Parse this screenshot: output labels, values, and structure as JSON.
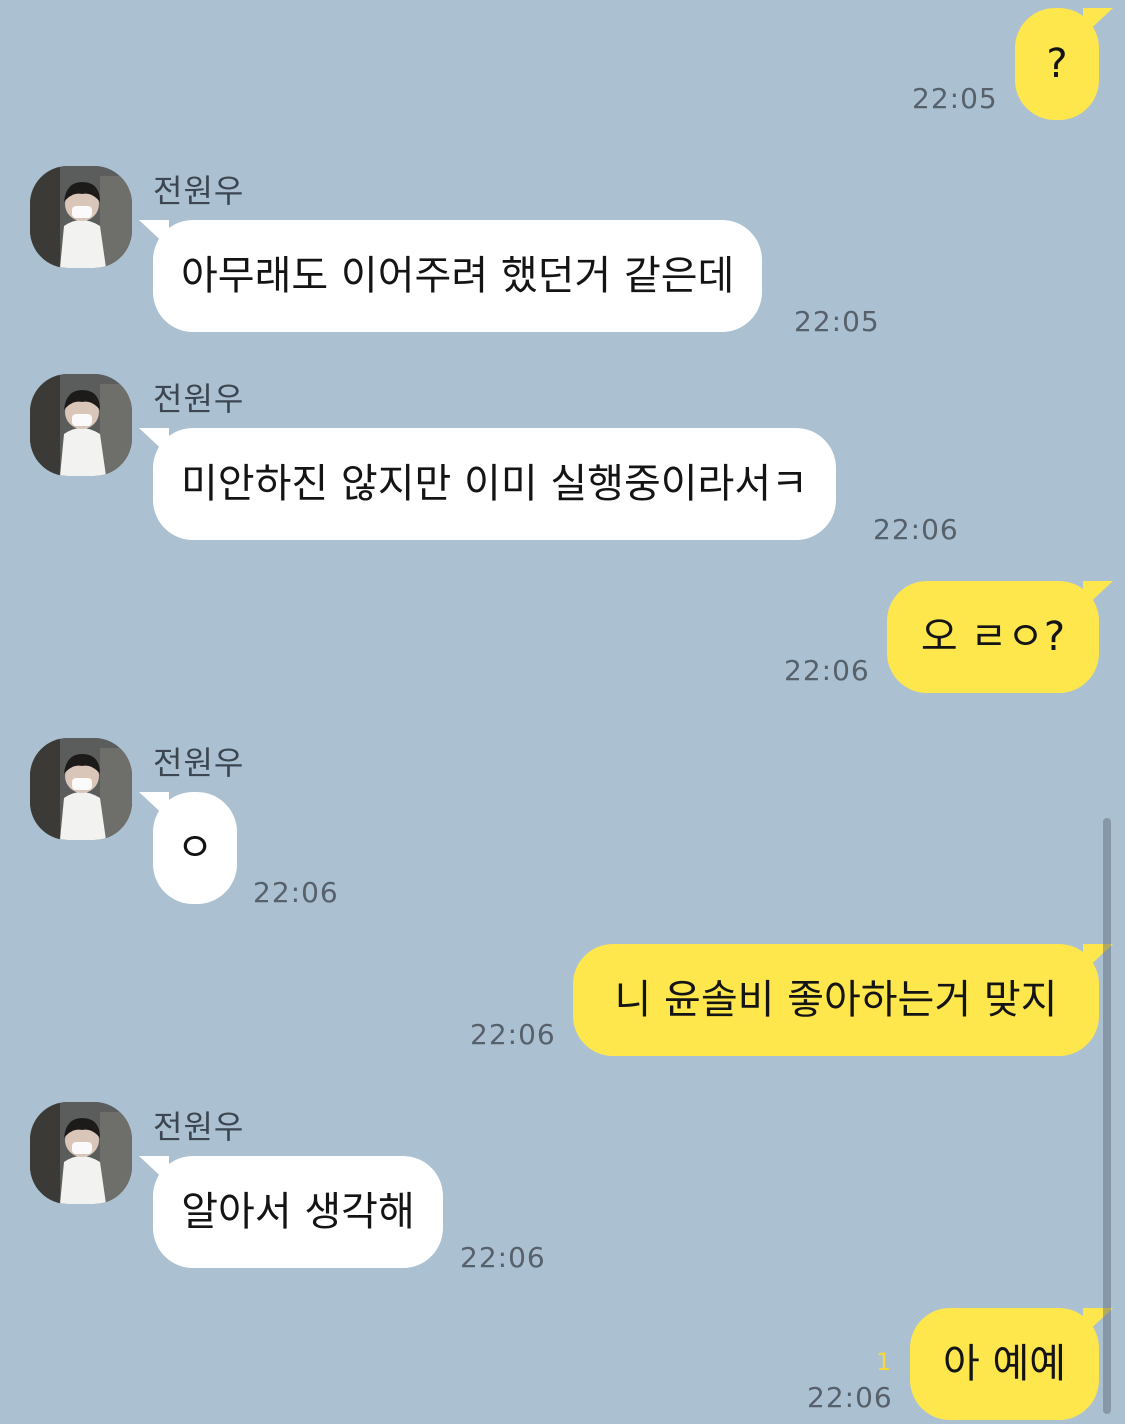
{
  "conversation": {
    "messages": [
      {
        "direction": "out",
        "text": "?",
        "time": "22:05"
      },
      {
        "direction": "in",
        "sender": "전원우",
        "text": "아무래도 이어주려 했던거 같은데",
        "time": "22:05"
      },
      {
        "direction": "in",
        "sender": "전원우",
        "text": "미안하진 않지만 이미 실행중이라서ㅋ",
        "time": "22:06"
      },
      {
        "direction": "out",
        "text": "오 ㄹㅇ?",
        "time": "22:06"
      },
      {
        "direction": "in",
        "sender": "전원우",
        "text": "ㅇ",
        "time": "22:06"
      },
      {
        "direction": "out",
        "text": "니 윤솔비 좋아하는거 맞지",
        "time": "22:06"
      },
      {
        "direction": "in",
        "sender": "전원우",
        "text": "알아서 생각해",
        "time": "22:06"
      },
      {
        "direction": "out",
        "text": "아 예예",
        "time": "22:06",
        "unread": "1"
      }
    ]
  },
  "colors": {
    "background": "#abc1d1",
    "incoming_bubble": "#ffffff",
    "outgoing_bubble": "#fee64d",
    "unread_count": "#f5d93a"
  },
  "icons": {
    "avatar": "profile-photo"
  }
}
